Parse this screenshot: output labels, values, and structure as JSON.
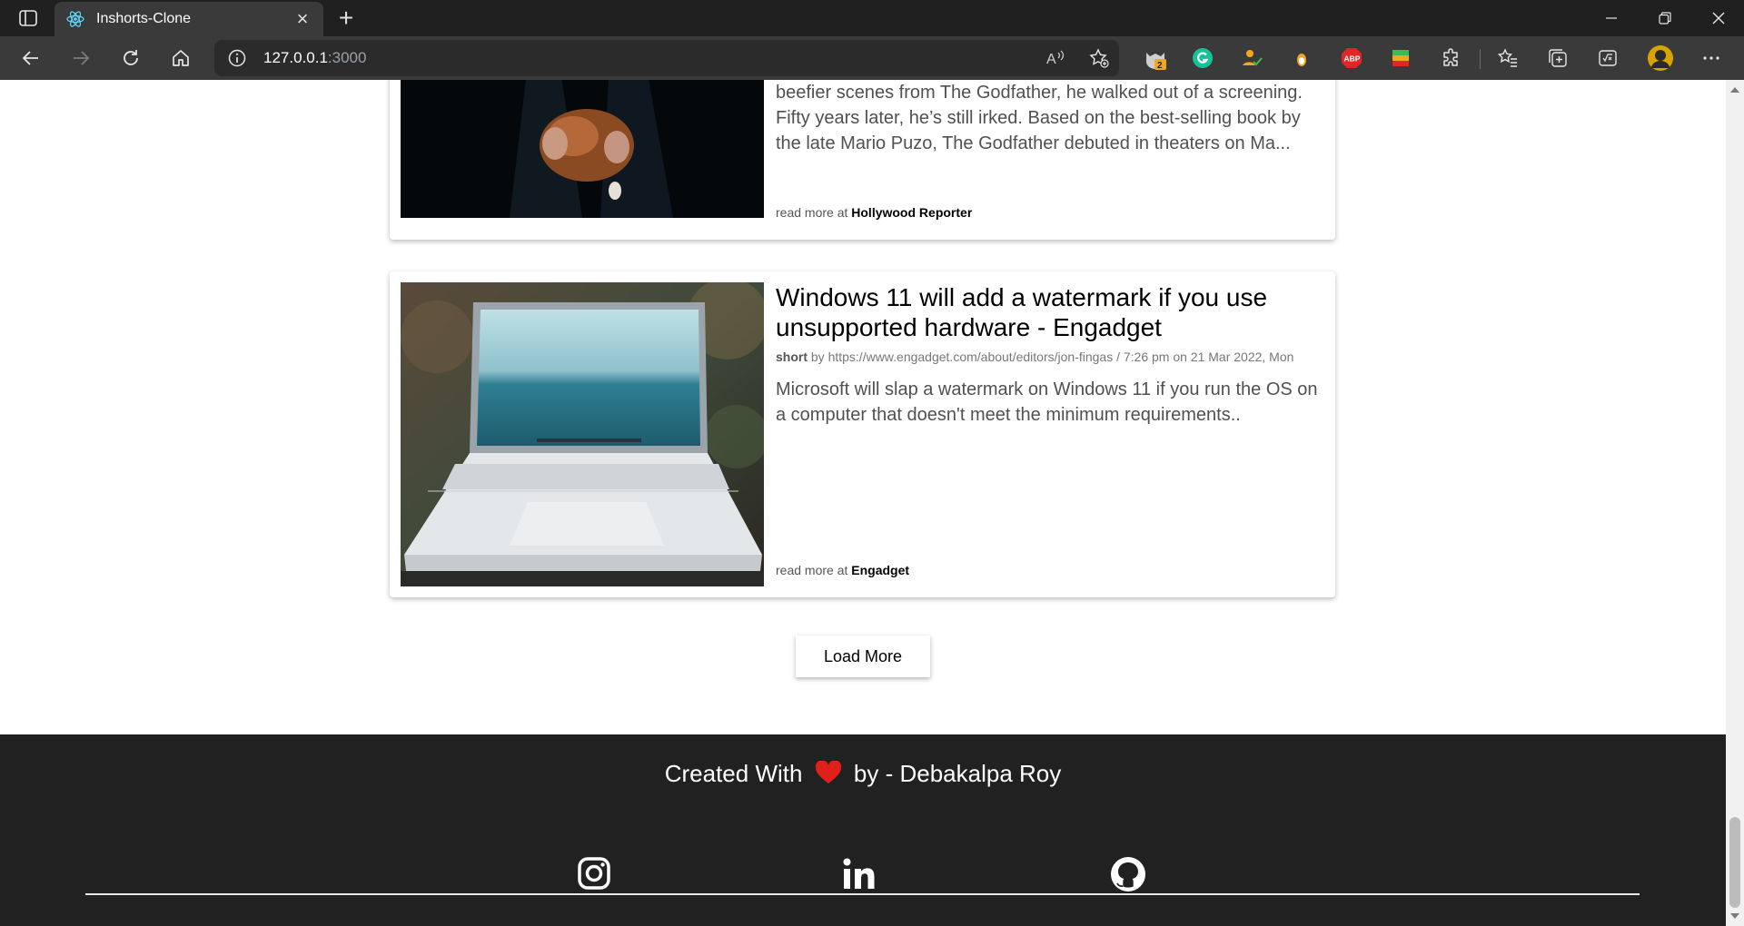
{
  "browser": {
    "tab_title": "Inshorts-Clone",
    "url_host": "127.0.0.1",
    "url_port": ":3000",
    "extension_badge": "2"
  },
  "articles": [
    {
      "headline": "",
      "description": "beefier scenes from The Godfather, he walked out of a screening. Fifty years later, he’s still irked. Based on the best-selling book by the late Mario Puzo, The Godfather debuted in theaters on Ma...",
      "read_more_prefix": "read more at",
      "source": "Hollywood Reporter"
    },
    {
      "headline": "Windows 11 will add a watermark if you use unsupported hardware - Engadget",
      "meta_label": "short",
      "meta_text": "by https://www.engadget.com/about/editors/jon-fingas / 7:26 pm on 21 Mar 2022, Mon",
      "description": "Microsoft will slap a watermark on Windows 11 if you run the OS on a computer that doesn't meet the minimum requirements..",
      "read_more_prefix": "read more at",
      "source": "Engadget"
    }
  ],
  "load_more_label": "Load More",
  "footer": {
    "credit_before": "Created With",
    "credit_after": "by - Debakalpa Roy",
    "heart_color": "#e0201b"
  }
}
